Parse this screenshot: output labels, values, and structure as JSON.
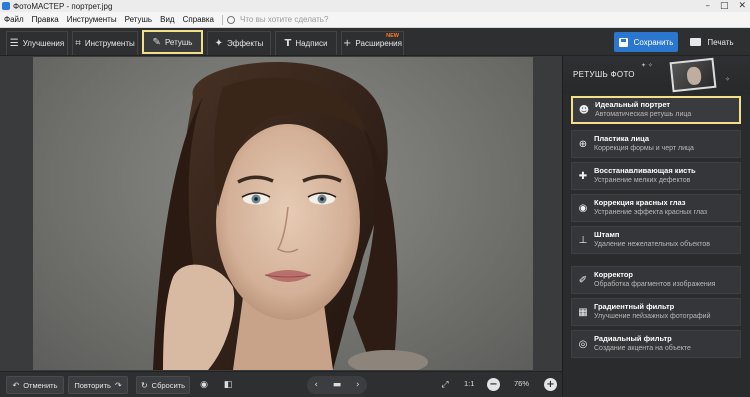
{
  "window": {
    "title": "ФотоМАСТЕР - портрет.jpg",
    "controls": [
      "–",
      "□",
      "✕"
    ]
  },
  "menu": {
    "items": [
      "Файл",
      "Правка",
      "Инструменты",
      "Ретушь",
      "Вид",
      "Справка"
    ],
    "search_placeholder": "Что вы хотите сделать?"
  },
  "toolbar": {
    "tabs": [
      {
        "label": "Улучшения",
        "icon": "sliders-icon"
      },
      {
        "label": "Инструменты",
        "icon": "crop-icon"
      },
      {
        "label": "Ретушь",
        "icon": "brush-icon",
        "active": true
      },
      {
        "label": "Эффекты",
        "icon": "magic-wand-icon"
      },
      {
        "label": "Надписи",
        "icon": "text-icon"
      },
      {
        "label": "Расширения",
        "icon": "plus-icon",
        "badge": "NEW"
      }
    ],
    "save_label": "Сохранить",
    "print_label": "Печать"
  },
  "panel": {
    "title": "РЕТУШЬ ФОТО",
    "tools": [
      {
        "name": "Идеальный портрет",
        "desc": "Автоматическая ретушь лица",
        "icon": "portrait-icon",
        "active": true
      },
      {
        "name": "Пластика лица",
        "desc": "Коррекция формы и черт лица",
        "icon": "face-shape-icon"
      },
      {
        "name": "Восстанавливающая кисть",
        "desc": "Устранение мелких дефектов",
        "icon": "healing-brush-icon"
      },
      {
        "name": "Коррекция красных глаз",
        "desc": "Устранение эффекта красных глаз",
        "icon": "eye-icon"
      },
      {
        "name": "Штамп",
        "desc": "Удаление нежелательных объектов",
        "icon": "stamp-icon"
      },
      {
        "name": "Корректор",
        "desc": "Обработка фрагментов изображения",
        "icon": "corrector-brush-icon"
      },
      {
        "name": "Градиентный фильтр",
        "desc": "Улучшение пейзажных фотографий",
        "icon": "gradient-filter-icon"
      },
      {
        "name": "Радиальный фильтр",
        "desc": "Создание акцента на объекте",
        "icon": "radial-filter-icon"
      }
    ]
  },
  "bottombar": {
    "undo_label": "Отменить",
    "redo_label": "Повторить",
    "reset_label": "Сбросить",
    "zoom_ratio": "1:1",
    "zoom_percent": "76%"
  },
  "colors": {
    "accent": "#2b77d0",
    "highlight": "#f2df8a",
    "badge": "#ff7a2a"
  }
}
